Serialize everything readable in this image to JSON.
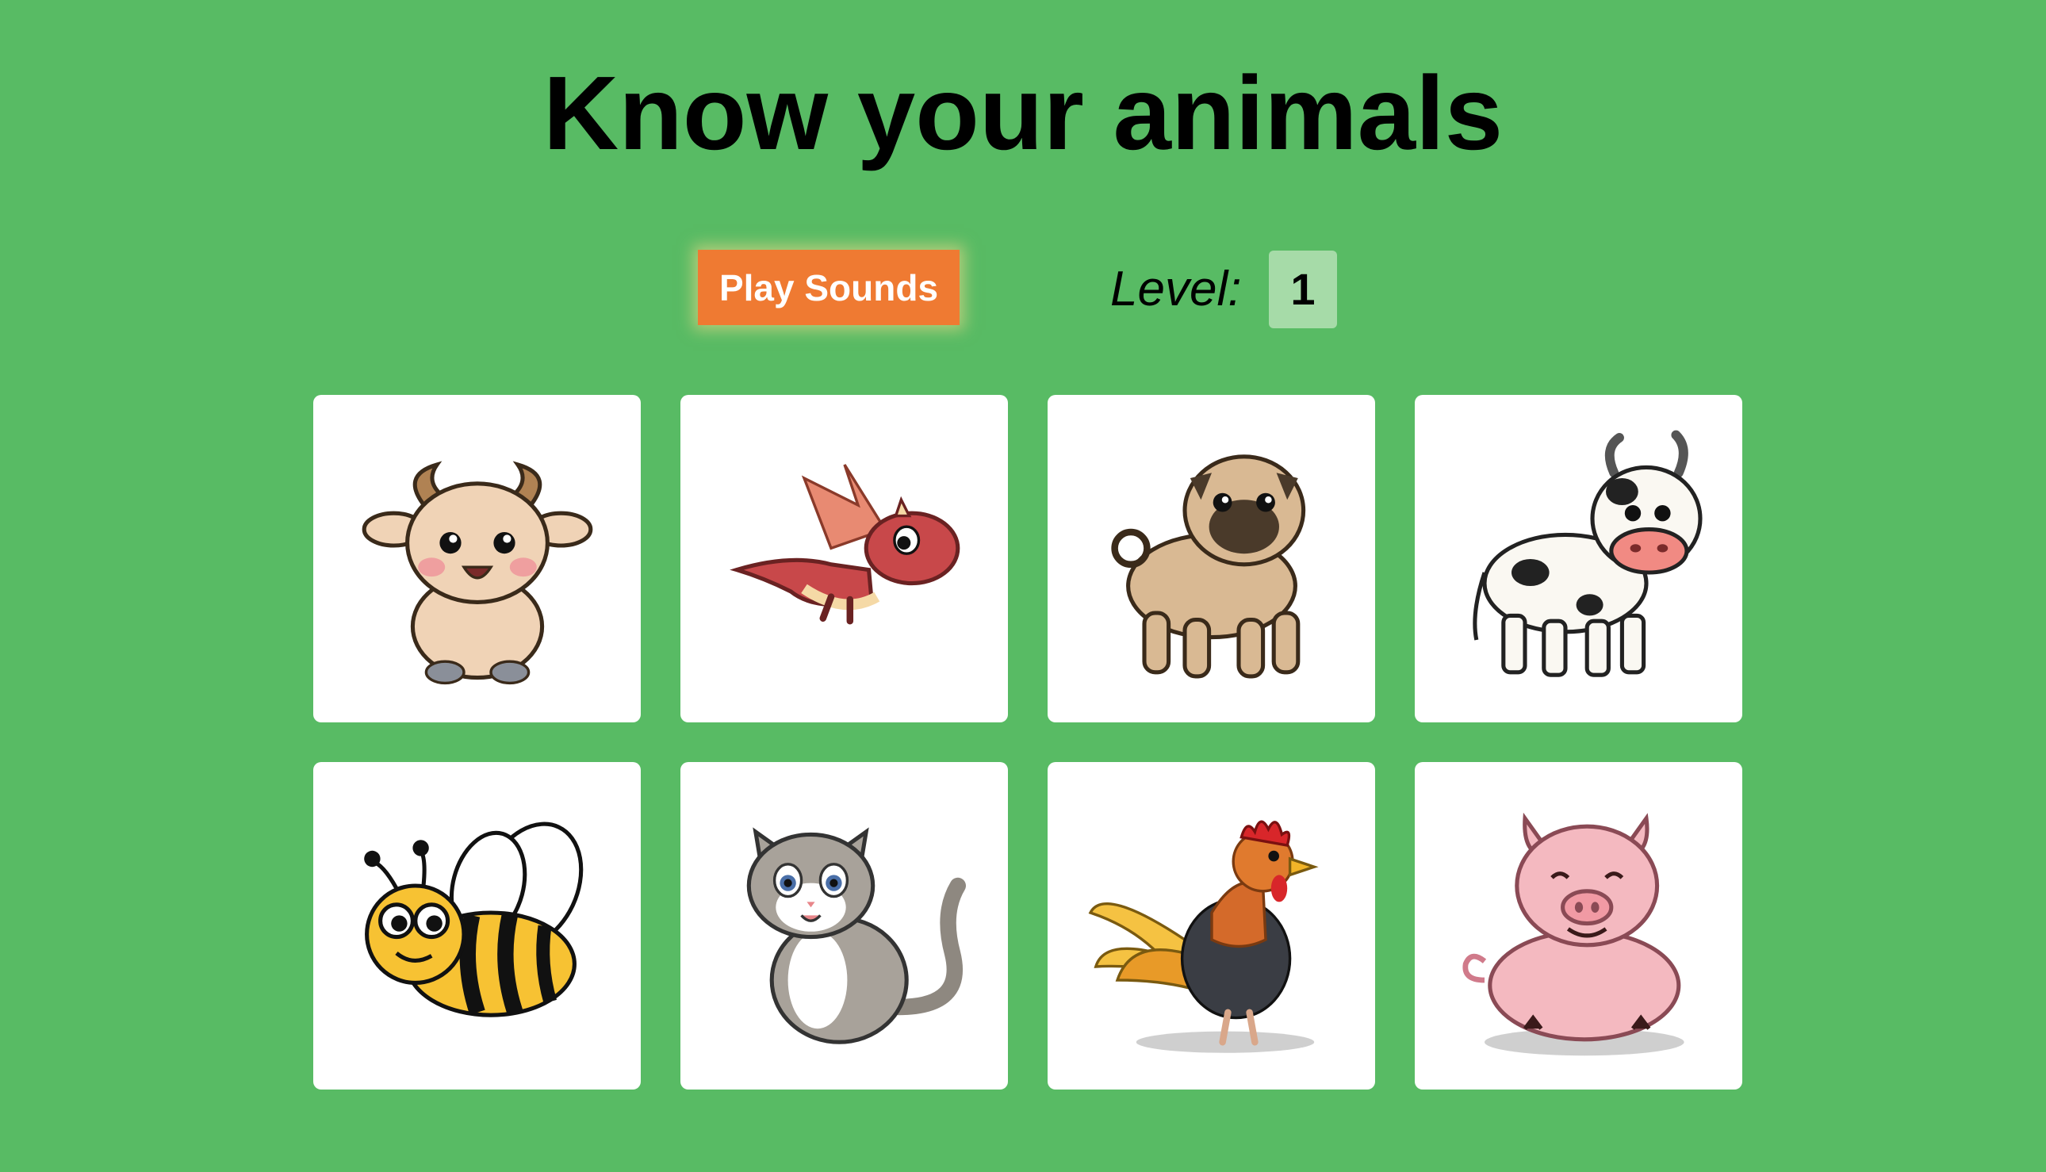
{
  "title": "Know your animals",
  "controls": {
    "play_label": "Play Sounds",
    "level_label": "Level:",
    "level_value": "1"
  },
  "colors": {
    "background": "#58bb64",
    "play_button": "#ef7a32",
    "level_badge": "#a6dba8",
    "card": "#ffffff"
  },
  "cards": [
    {
      "animal": "goat",
      "icon": "goat-icon"
    },
    {
      "animal": "dragon",
      "icon": "dragon-icon"
    },
    {
      "animal": "pug",
      "icon": "pug-icon"
    },
    {
      "animal": "cow",
      "icon": "cow-icon"
    },
    {
      "animal": "bee",
      "icon": "bee-icon"
    },
    {
      "animal": "cat",
      "icon": "cat-icon"
    },
    {
      "animal": "rooster",
      "icon": "rooster-icon"
    },
    {
      "animal": "pig",
      "icon": "pig-icon"
    }
  ]
}
